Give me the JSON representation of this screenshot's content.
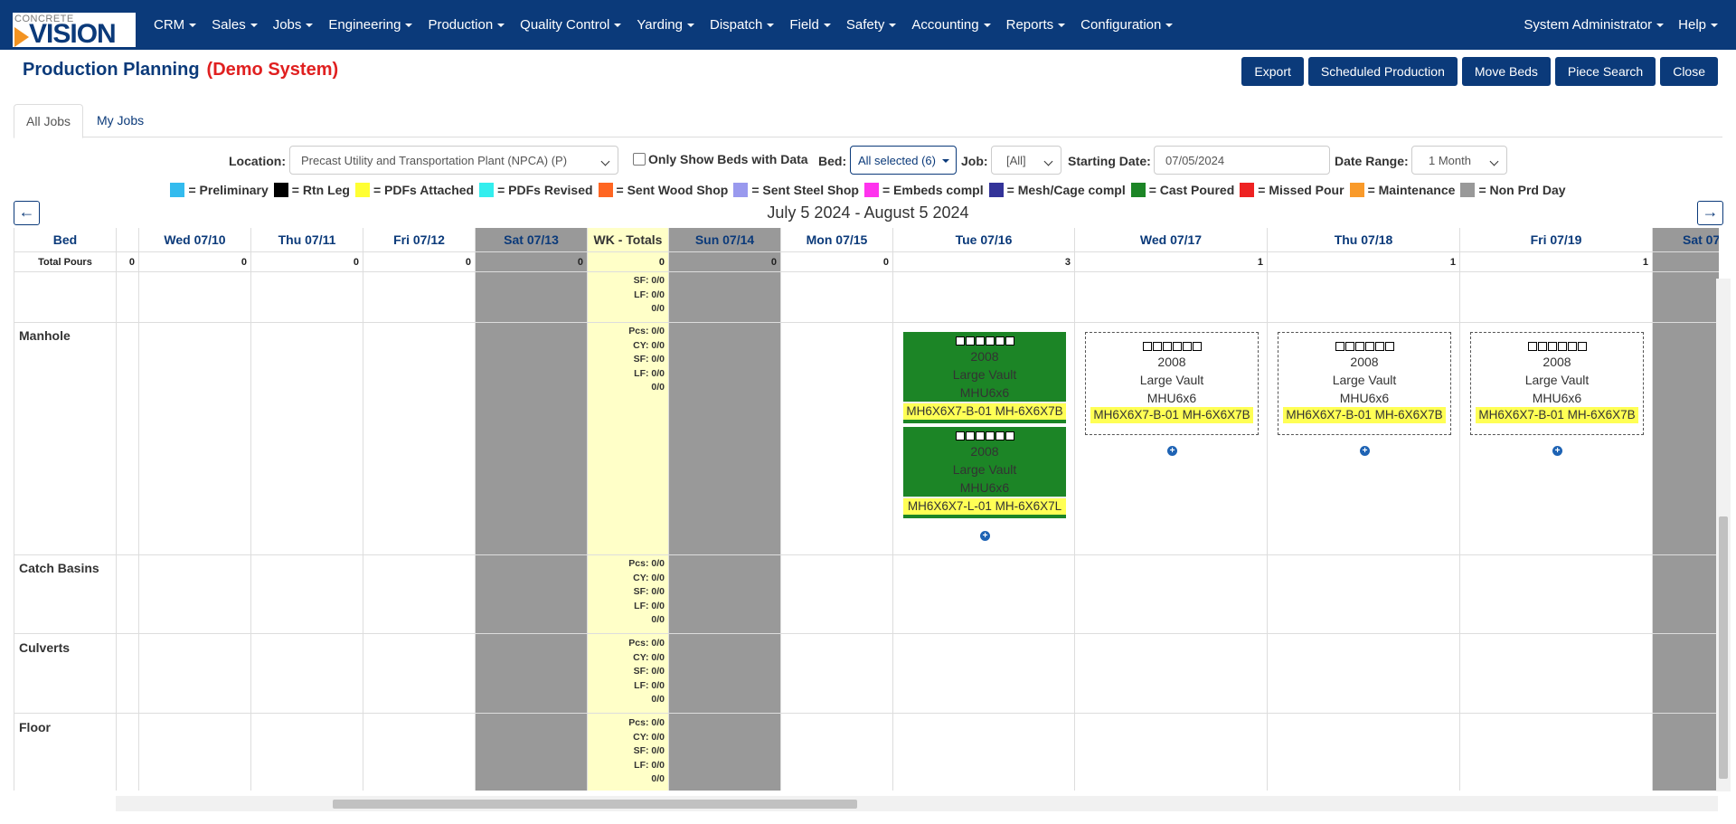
{
  "logo": {
    "top": "CONCRETE",
    "main": "VISION"
  },
  "nav": {
    "items": [
      "CRM",
      "Sales",
      "Jobs",
      "Engineering",
      "Production",
      "Quality Control",
      "Yarding",
      "Dispatch",
      "Field",
      "Safety",
      "Accounting",
      "Reports",
      "Configuration"
    ],
    "user": "System Administrator",
    "help": "Help"
  },
  "page": {
    "title": "Production Planning",
    "subtitle": "(Demo System)"
  },
  "toolbar": {
    "export": "Export",
    "scheduled": "Scheduled Production",
    "move_beds": "Move Beds",
    "piece_search": "Piece Search",
    "close": "Close"
  },
  "tabs": {
    "all_jobs": "All Jobs",
    "my_jobs": "My Jobs"
  },
  "filters": {
    "location_label": "Location:",
    "location_value": "Precast Utility and Transportation Plant (NPCA) (P)",
    "only_beds_label": "Only Show Beds with Data",
    "bed_label": "Bed:",
    "bed_value": "All selected (6)",
    "job_label": "Job:",
    "job_value": "[All]",
    "start_label": "Starting Date:",
    "start_value": "07/05/2024",
    "range_label": "Date Range:",
    "range_value": "1 Month"
  },
  "legend": [
    {
      "label": "= Preliminary",
      "color": "#33bbee"
    },
    {
      "label": "= Rtn Leg",
      "color": "#000000"
    },
    {
      "label": "= PDFs Attached",
      "color": "#ffff33"
    },
    {
      "label": "= PDFs Revised",
      "color": "#33eeee"
    },
    {
      "label": "= Sent Wood Shop",
      "color": "#ff6622"
    },
    {
      "label": "= Sent Steel Shop",
      "color": "#9999ee"
    },
    {
      "label": "= Embeds compl",
      "color": "#ff33ee"
    },
    {
      "label": "= Mesh/Cage compl",
      "color": "#333399"
    },
    {
      "label": "= Cast Poured",
      "color": "#1c8526"
    },
    {
      "label": "= Missed Pour",
      "color": "#ee2222"
    },
    {
      "label": "= Maintenance",
      "color": "#f99a2a"
    },
    {
      "label": "= Non Prd Day",
      "color": "#999999"
    }
  ],
  "date_range": "July 5 2024 - August 5 2024",
  "grid": {
    "bed_header": "Bed",
    "total_label": "Total Pours",
    "columns": [
      {
        "label": "",
        "total": "0"
      },
      {
        "label": "Wed 07/10",
        "total": "0"
      },
      {
        "label": "Thu 07/11",
        "total": "0"
      },
      {
        "label": "Fri 07/12",
        "total": "0"
      },
      {
        "label": "Sat 07/13",
        "total": "0"
      },
      {
        "label": "WK - Totals",
        "total": "0"
      },
      {
        "label": "Sun 07/14",
        "total": "0"
      },
      {
        "label": "Mon 07/15",
        "total": "0"
      },
      {
        "label": "Tue 07/16",
        "total": "3"
      },
      {
        "label": "Wed 07/17",
        "total": "1"
      },
      {
        "label": "Thu 07/18",
        "total": "1"
      },
      {
        "label": "Fri 07/19",
        "total": "1"
      },
      {
        "label": "Sat 07",
        "total": ""
      }
    ],
    "beds": [
      "Manhole",
      "Catch Basins",
      "Culverts",
      "Floor"
    ],
    "wk_stats_top": [
      "SF: 0/0",
      "LF: 0/0",
      "0/0"
    ],
    "wk_stats": [
      "Pcs: 0/0",
      "CY: 0/0",
      "SF: 0/0",
      "LF: 0/0",
      "0/0"
    ]
  },
  "cards": {
    "tue_1": {
      "job": "2008",
      "name": "Large Vault",
      "product": "MHU6x6",
      "pieces": "MH6X6X7-B-01 MH-6X6X7B"
    },
    "tue_2": {
      "job": "2008",
      "name": "Large Vault",
      "product": "MHU6x6",
      "pieces": "MH6X6X7-L-01 MH-6X6X7L"
    },
    "wed": {
      "job": "2008",
      "name": "Large Vault",
      "product": "MHU6x6",
      "pieces": "MH6X6X7-B-01 MH-6X6X7B"
    },
    "thu": {
      "job": "2008",
      "name": "Large Vault",
      "product": "MHU6x6",
      "pieces": "MH6X6X7-B-01 MH-6X6X7B"
    },
    "fri": {
      "job": "2008",
      "name": "Large Vault",
      "product": "MHU6x6",
      "pieces": "MH6X6X7-B-01 MH-6X6X7B"
    }
  }
}
